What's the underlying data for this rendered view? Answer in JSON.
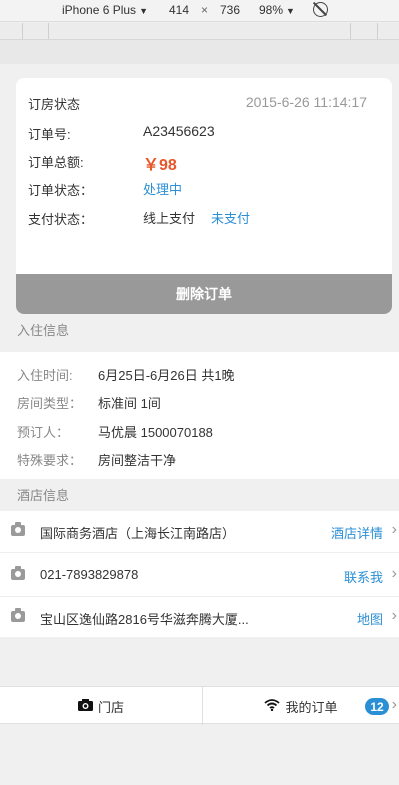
{
  "devtools": {
    "device": "iPhone 6 Plus",
    "width": "414",
    "times": "×",
    "height": "736",
    "zoom": "98%"
  },
  "order": {
    "title": "订房状态",
    "datetime": "2015-6-26  11:14:17",
    "number_label": "订单号:",
    "number": "A23456623",
    "total_label": "订单总额:",
    "total": "￥98",
    "status_label": "订单状态：",
    "status": "处理中",
    "pay_label": "支付状态：",
    "pay_method": "线上支付",
    "pay_status": "未支付",
    "delete_button": "删除订单"
  },
  "checkin": {
    "section_title": "入住信息",
    "time_label": "入住时间:",
    "time_value": "6月25日-6月26日   共1晚",
    "room_label": "房间类型：",
    "room_value": "标准间   1间",
    "booker_label": "预订人：",
    "booker_value": "马优晨   1500070188",
    "request_label": "特殊要求：",
    "request_value": "房间整洁干净"
  },
  "hotel": {
    "section_title": "酒店信息",
    "name": "国际商务酒店（上海长江南路店）",
    "detail_link": "酒店详情",
    "phone": "021-7893829878",
    "contact_link": "联系我",
    "address": "宝山区逸仙路2816号华滋奔腾大厦...",
    "map_link": "地图"
  },
  "tabbar": {
    "store_label": "门店",
    "orders_label": "我的订单",
    "orders_badge": "12"
  },
  "colors": {
    "accent": "#2b8fd6",
    "price": "#e8562a",
    "button_gray": "#999999"
  }
}
